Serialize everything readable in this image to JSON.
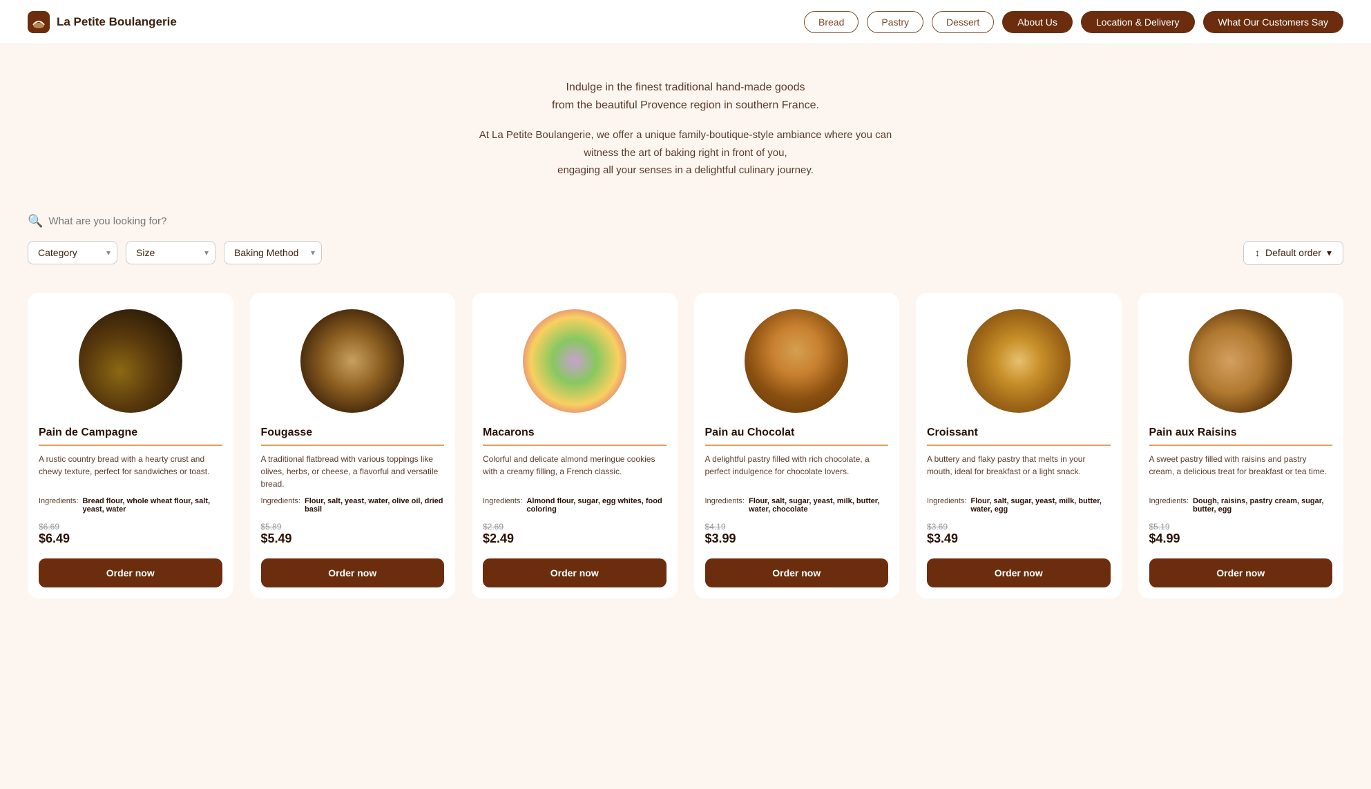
{
  "brand": {
    "name": "La Petite Boulangerie"
  },
  "nav": {
    "links": [
      {
        "id": "bread",
        "label": "Bread",
        "style": "outline"
      },
      {
        "id": "pastry",
        "label": "Pastry",
        "style": "outline"
      },
      {
        "id": "dessert",
        "label": "Dessert",
        "style": "outline"
      },
      {
        "id": "about-us",
        "label": "About Us",
        "style": "filled"
      },
      {
        "id": "location-delivery",
        "label": "Location & Delivery",
        "style": "filled"
      },
      {
        "id": "customers-say",
        "label": "What Our Customers Say",
        "style": "filled"
      }
    ]
  },
  "hero": {
    "tagline_line1": "Indulge in the finest traditional hand-made goods",
    "tagline_line2": "from the beautiful Provence region in southern France.",
    "desc_line1": "At La Petite Boulangerie, we offer a unique family-boutique-style ambiance where you can",
    "desc_line2": "witness the art of baking right in front of you,",
    "desc_line3": "engaging all your senses in a delightful culinary journey."
  },
  "search": {
    "placeholder": "What are you looking for?"
  },
  "filters": {
    "category_label": "Category",
    "size_label": "Size",
    "baking_method_label": "Baking Method",
    "sort_label": "Default order",
    "sort_icon": "↕"
  },
  "products": [
    {
      "id": "pain-de-campagne",
      "name": "Pain de Campagne",
      "image_class": "img-pain-campagne",
      "description": "A rustic country bread with a hearty crust and chewy texture, perfect for sandwiches or toast.",
      "ingredients_label": "Ingredients:",
      "ingredients": "Bread flour, whole wheat flour, salt, yeast, water",
      "price_old": "$6.69",
      "price_new": "$6.49",
      "order_label": "Order now"
    },
    {
      "id": "fougasse",
      "name": "Fougasse",
      "image_class": "img-fougasse",
      "description": "A traditional flatbread with various toppings like olives, herbs, or cheese, a flavorful and versatile bread.",
      "ingredients_label": "Ingredients:",
      "ingredients": "Flour, salt, yeast, water, olive oil, dried basil",
      "price_old": "$5.89",
      "price_new": "$5.49",
      "order_label": "Order now"
    },
    {
      "id": "macarons",
      "name": "Macarons",
      "image_class": "img-macarons",
      "description": "Colorful and delicate almond meringue cookies with a creamy filling, a French classic.",
      "ingredients_label": "Ingredients:",
      "ingredients": "Almond flour, sugar, egg whites, food coloring",
      "price_old": "$2.69",
      "price_new": "$2.49",
      "order_label": "Order now"
    },
    {
      "id": "pain-au-chocolat",
      "name": "Pain au Chocolat",
      "image_class": "img-pain-chocolat",
      "description": "A delightful pastry filled with rich chocolate, a perfect indulgence for chocolate lovers.",
      "ingredients_label": "Ingredients:",
      "ingredients": "Flour, salt, sugar, yeast, milk, butter, water, chocolate",
      "price_old": "$4.19",
      "price_new": "$3.99",
      "order_label": "Order now"
    },
    {
      "id": "croissant",
      "name": "Croissant",
      "image_class": "img-croissant",
      "description": "A buttery and flaky pastry that melts in your mouth, ideal for breakfast or a light snack.",
      "ingredients_label": "Ingredients:",
      "ingredients": "Flour, salt, sugar, yeast, milk, butter, water, egg",
      "price_old": "$3.69",
      "price_new": "$3.49",
      "order_label": "Order now"
    },
    {
      "id": "pain-aux-raisins",
      "name": "Pain aux Raisins",
      "image_class": "img-pain-raisins",
      "description": "A sweet pastry filled with raisins and pastry cream, a delicious treat for breakfast or tea time.",
      "ingredients_label": "Ingredients:",
      "ingredients": "Dough, raisins, pastry cream, sugar, butter, egg",
      "price_old": "$5.19",
      "price_new": "$4.99",
      "order_label": "Order now"
    }
  ]
}
